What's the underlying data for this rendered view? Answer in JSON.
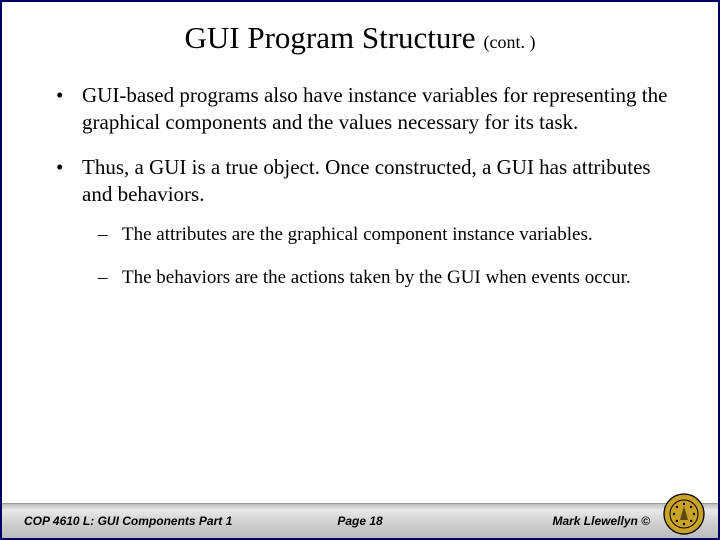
{
  "title": {
    "main": "GUI Program Structure",
    "suffix": "(cont. )"
  },
  "bullets": [
    "GUI-based programs also have instance variables for representing the graphical components and the values necessary for its task.",
    "Thus, a GUI is a true object.  Once constructed, a GUI has attributes and behaviors."
  ],
  "sub_bullets": [
    "The attributes are the graphical component instance variables.",
    "The behaviors are the actions taken by the GUI when events occur."
  ],
  "footer": {
    "course": "COP 4610 L: GUI Components Part 1",
    "page": "Page 18",
    "author": "Mark Llewellyn ©"
  }
}
